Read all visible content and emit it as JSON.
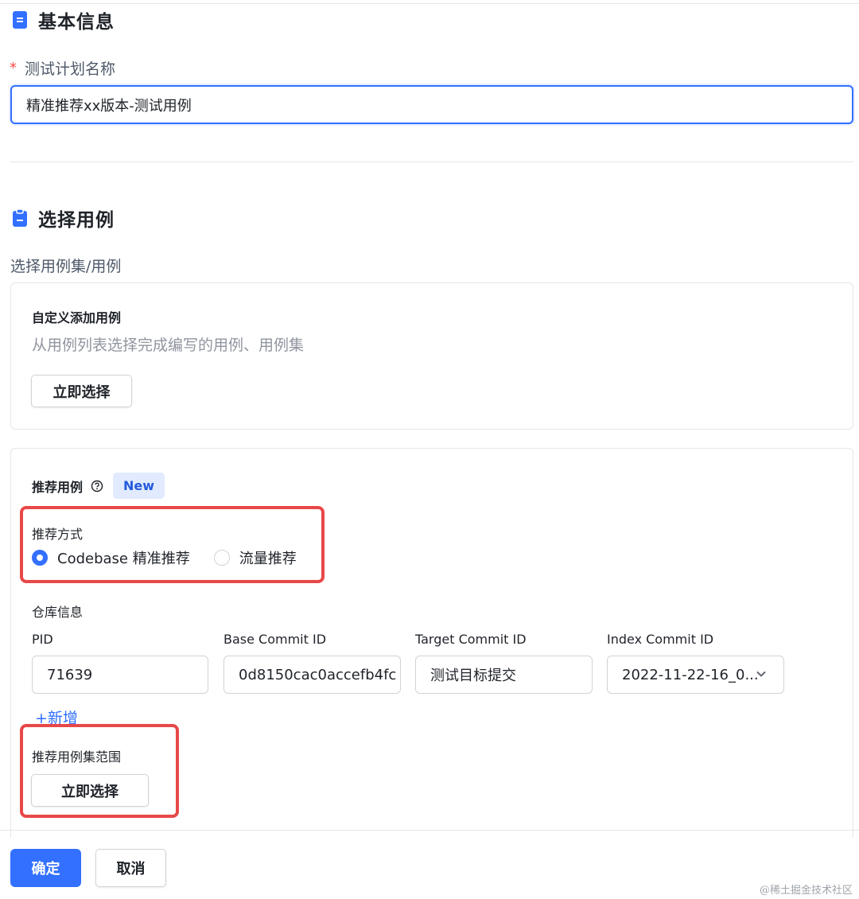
{
  "basic": {
    "title": "基本信息",
    "icon": "document-icon",
    "name_label": "测试计划名称",
    "required_mark": "*",
    "name_value": "精准推荐xx版本-测试用例"
  },
  "cases": {
    "title": "选择用例",
    "icon": "clipboard-icon",
    "subtitle": "选择用例集/用例",
    "custom": {
      "title": "自定义添加用例",
      "desc": "从用例列表选择完成编写的用例、用例集",
      "select_label": "立即选择"
    },
    "recommend": {
      "title": "推荐用例",
      "badge": "New",
      "mode_label": "推荐方式",
      "modes": [
        {
          "label": "Codebase 精准推荐",
          "selected": true
        },
        {
          "label": "流量推荐",
          "selected": false
        }
      ],
      "repo_label": "仓库信息",
      "columns": [
        "PID",
        "Base Commit ID",
        "Target Commit ID",
        "Index Commit ID"
      ],
      "values": {
        "pid": "71639",
        "base_commit": "0d8150cac0accefb4fc",
        "target_commit": "测试目标提交",
        "index_commit": "2022-11-22-16_0..."
      },
      "add_label": "+新增",
      "scope_label": "推荐用例集范围",
      "scope_select_label": "立即选择"
    }
  },
  "footer": {
    "confirm_label": "确定",
    "cancel_label": "取消"
  },
  "watermark": "@稀土掘金技术社区",
  "colors": {
    "accent": "#3370ff",
    "highlight_box": "#e84848",
    "badge_bg": "#e1eaff"
  }
}
